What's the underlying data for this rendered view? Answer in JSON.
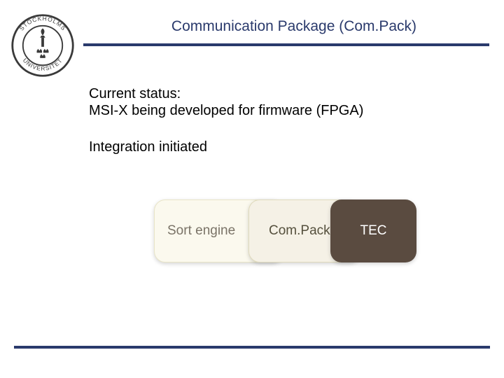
{
  "logo": {
    "institution": "Stockholm University",
    "ring_text_top": "STOCKHOLMS",
    "ring_text_bottom": "UNIVERSITET"
  },
  "title": "Communication Package (Com.Pack)",
  "body": {
    "status_label": "Current status:",
    "status_line": "MSI-X being developed for firmware (FPGA)",
    "integration_line": "Integration initiated"
  },
  "blocks": {
    "sort": "Sort engine",
    "compack": "Com.Pack",
    "tec": "TEC"
  },
  "colors": {
    "accent": "#2a3a6c",
    "block_dark": "#5a4b40",
    "block_mid": "#f5f1e6",
    "block_light": "#fbf9ee"
  }
}
